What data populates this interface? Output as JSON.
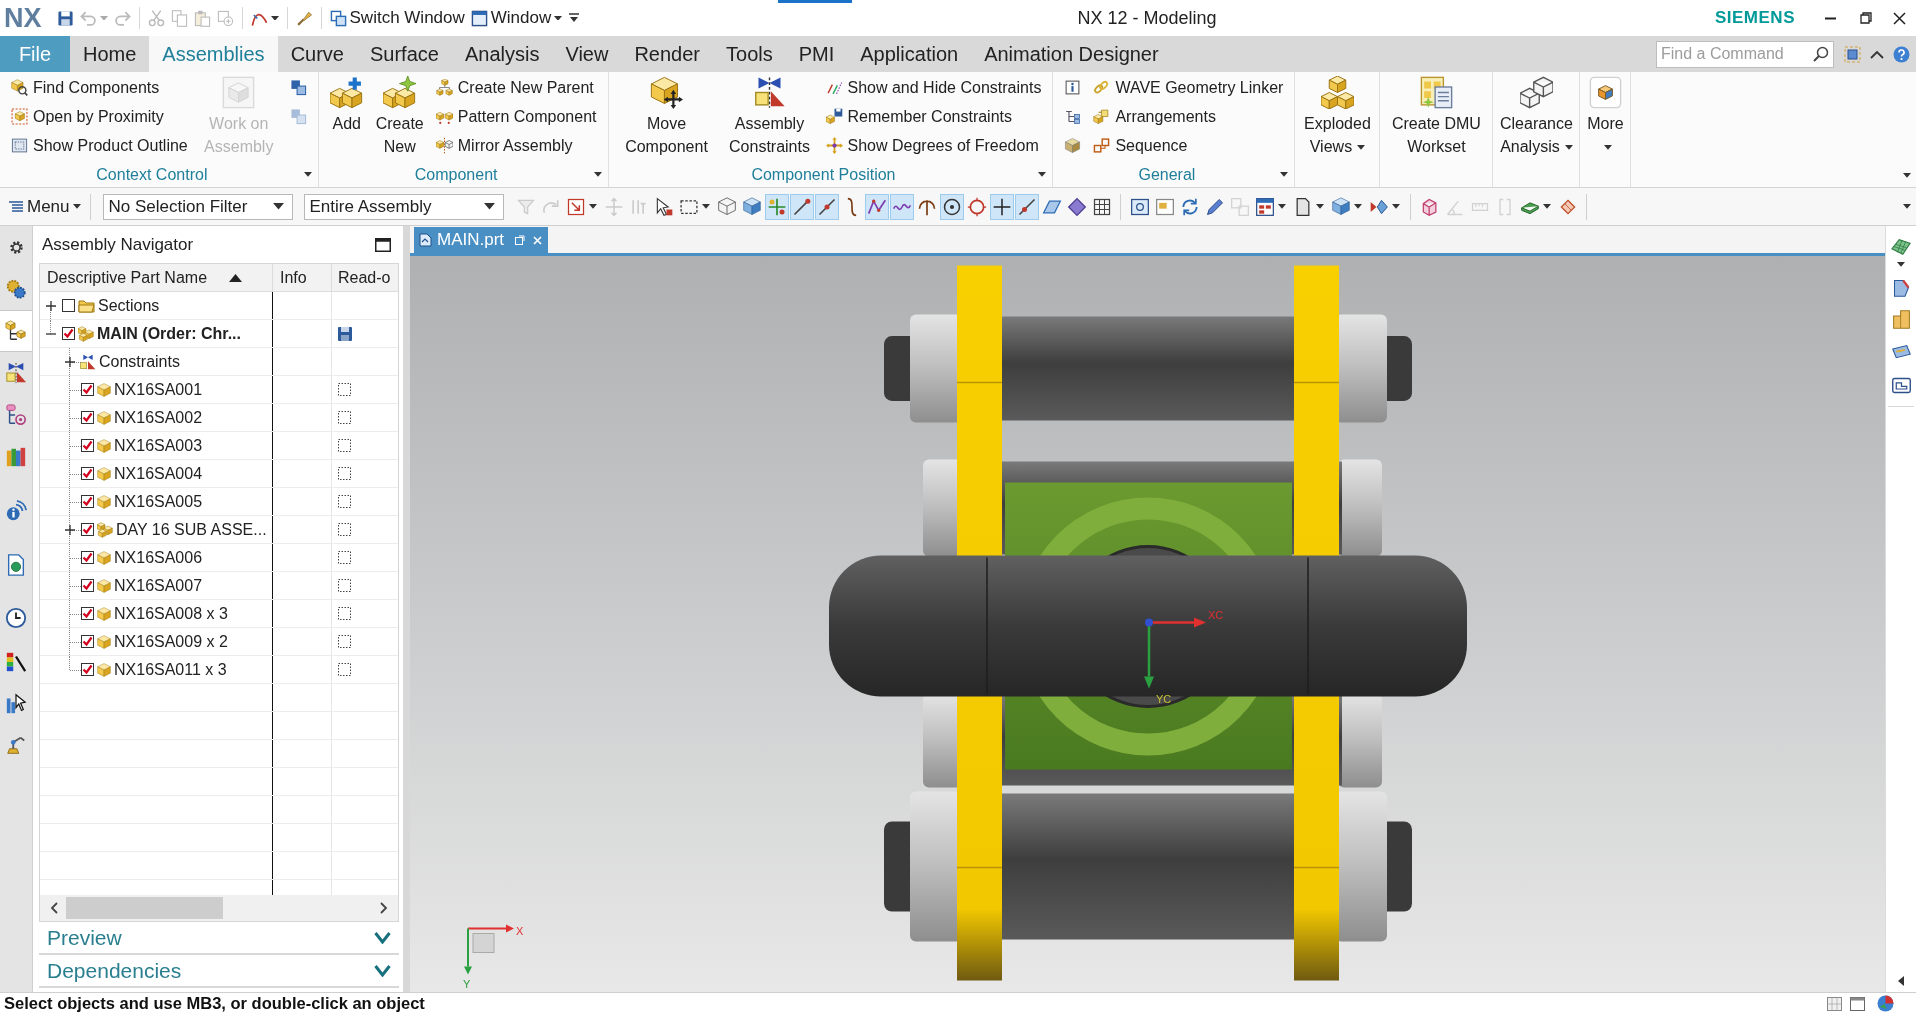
{
  "title_bar": {
    "logo": "NX",
    "title": "NX 12 - Modeling",
    "brand": "SIEMENS",
    "quick_access": [
      {
        "items": [
          {
            "disabled": false,
            "dropdown": false
          },
          {
            "disabled": true,
            "dropdown": true
          },
          {
            "disabled": true,
            "dropdown": false
          }
        ]
      },
      {
        "items": [
          {
            "disabled": true,
            "dropdown": false
          },
          {
            "disabled": true,
            "dropdown": false
          },
          {
            "disabled": true,
            "dropdown": false
          },
          {
            "disabled": true,
            "dropdown": false
          }
        ]
      },
      {
        "items": [
          {
            "disabled": false,
            "dropdown": true
          }
        ]
      },
      {
        "items": [
          {
            "disabled": false,
            "dropdown": false
          }
        ]
      },
      {
        "items": [
          {
            "label": "Switch Window",
            "disabled": false,
            "dropdown": false
          },
          {
            "label": "Window",
            "disabled": false,
            "dropdown": true
          }
        ]
      }
    ]
  },
  "ribbon_tabs": [
    {
      "label": "File",
      "kind": "file",
      "selected": false
    },
    {
      "label": "Home",
      "kind": "tab",
      "selected": false
    },
    {
      "label": "Assemblies",
      "kind": "tab",
      "selected": true
    },
    {
      "label": "Curve",
      "kind": "tab",
      "selected": false
    },
    {
      "label": "Surface",
      "kind": "tab",
      "selected": false
    },
    {
      "label": "Analysis",
      "kind": "tab",
      "selected": false
    },
    {
      "label": "View",
      "kind": "tab",
      "selected": false
    },
    {
      "label": "Render",
      "kind": "tab",
      "selected": false
    },
    {
      "label": "Tools",
      "kind": "tab",
      "selected": false
    },
    {
      "label": "PMI",
      "kind": "tab",
      "selected": false
    },
    {
      "label": "Application",
      "kind": "tab",
      "selected": false
    },
    {
      "label": "Animation Designer",
      "kind": "tab",
      "selected": false
    }
  ],
  "command_finder": {
    "placeholder": "Find a Command"
  },
  "ribbon_groups": [
    {
      "title": "Context Control",
      "blocks": [
        {
          "kind": "stack",
          "items": [
            {
              "label": "Find Components",
              "disabled": false
            },
            {
              "label": "Open by Proximity",
              "disabled": false
            },
            {
              "label": "Show Product Outline",
              "disabled": false
            }
          ]
        },
        {
          "kind": "large",
          "label": "Work on Assembly",
          "disabled": true,
          "dropdown": false
        },
        {
          "kind": "stack",
          "items": [
            {
              "disabled": false
            },
            {
              "disabled": true
            }
          ]
        }
      ]
    },
    {
      "title": "Component",
      "blocks": [
        {
          "kind": "large",
          "label": "Add",
          "disabled": false,
          "dropdown": false
        },
        {
          "kind": "large",
          "label": "Create New",
          "disabled": false,
          "dropdown": false
        },
        {
          "kind": "stack",
          "items": [
            {
              "label": "Create New Parent",
              "disabled": false
            },
            {
              "label": "Pattern Component",
              "disabled": false
            },
            {
              "label": "Mirror Assembly",
              "disabled": false
            }
          ]
        }
      ]
    },
    {
      "title": "Component Position",
      "blocks": [
        {
          "kind": "large",
          "label": "Move Component",
          "disabled": false,
          "dropdown": false
        },
        {
          "kind": "large",
          "label": "Assembly Constraints",
          "disabled": false,
          "dropdown": false
        },
        {
          "kind": "stack",
          "items": [
            {
              "label": "Show and Hide Constraints",
              "disabled": false
            },
            {
              "label": "Remember Constraints",
              "disabled": false
            },
            {
              "label": "Show Degrees of Freedom",
              "disabled": false
            }
          ]
        }
      ]
    },
    {
      "title": "General",
      "blocks": [
        {
          "kind": "stack",
          "items": [
            {
              "disabled": false
            },
            {
              "disabled": false
            },
            {
              "disabled": false
            }
          ]
        },
        {
          "kind": "stack",
          "items": [
            {
              "label": "WAVE Geometry Linker",
              "disabled": false
            },
            {
              "label": "Arrangements",
              "disabled": false
            },
            {
              "label": "Sequence",
              "disabled": false
            }
          ]
        }
      ]
    },
    {
      "blocks": [
        {
          "kind": "large",
          "label": "Exploded Views",
          "disabled": false,
          "dropdown": true
        }
      ]
    },
    {
      "blocks": [
        {
          "kind": "large",
          "label": "Create DMU Workset",
          "disabled": false,
          "dropdown": false
        }
      ]
    },
    {
      "blocks": [
        {
          "kind": "large",
          "label": "Clearance Analysis",
          "disabled": false,
          "dropdown": true
        }
      ]
    },
    {
      "blocks": [
        {
          "kind": "large",
          "label": "More",
          "disabled": false,
          "dropdown": true
        }
      ]
    }
  ],
  "selection_bar": {
    "menu": "Menu",
    "filters": [
      {
        "value": "No Selection Filter"
      },
      {
        "value": "Entire Assembly"
      }
    ],
    "tools": [
      {
        "items": [
          {
            "on": false,
            "disabled": true,
            "dropdown": false
          },
          {
            "on": false,
            "disabled": true,
            "dropdown": false
          },
          {
            "on": false,
            "disabled": false,
            "dropdown": true
          },
          {
            "on": false,
            "disabled": true,
            "dropdown": false
          },
          {
            "on": false,
            "disabled": true,
            "dropdown": false
          },
          {
            "on": false,
            "disabled": false,
            "dropdown": false
          },
          {
            "on": false,
            "disabled": false,
            "dropdown": true
          },
          {
            "on": false,
            "disabled": false,
            "dropdown": false
          },
          {
            "on": false,
            "disabled": false,
            "dropdown": false
          },
          {
            "on": true,
            "disabled": false,
            "dropdown": false
          },
          {
            "on": true,
            "disabled": false,
            "dropdown": false
          },
          {
            "on": true,
            "disabled": false,
            "dropdown": false
          },
          {
            "on": false,
            "disabled": false,
            "dropdown": false
          },
          {
            "on": true,
            "disabled": false,
            "dropdown": false
          },
          {
            "on": true,
            "disabled": false,
            "dropdown": false
          },
          {
            "on": false,
            "disabled": false,
            "dropdown": false
          },
          {
            "on": true,
            "disabled": false,
            "dropdown": false
          },
          {
            "on": false,
            "disabled": false,
            "dropdown": false
          },
          {
            "on": true,
            "disabled": false,
            "dropdown": false
          },
          {
            "on": true,
            "disabled": false,
            "dropdown": false
          },
          {
            "on": false,
            "disabled": false,
            "dropdown": false
          },
          {
            "on": false,
            "disabled": false,
            "dropdown": false
          },
          {
            "on": false,
            "disabled": false,
            "dropdown": false
          }
        ]
      },
      {
        "items": [
          {
            "on": false,
            "disabled": false,
            "dropdown": false
          },
          {
            "on": false,
            "disabled": false,
            "dropdown": false
          },
          {
            "on": false,
            "disabled": false,
            "dropdown": false
          },
          {
            "on": false,
            "disabled": false,
            "dropdown": false
          },
          {
            "on": false,
            "disabled": true,
            "dropdown": false
          },
          {
            "on": false,
            "disabled": false,
            "dropdown": true
          },
          {
            "on": false,
            "disabled": false,
            "dropdown": true
          },
          {
            "on": false,
            "disabled": false,
            "dropdown": true
          },
          {
            "on": false,
            "disabled": false,
            "dropdown": true
          }
        ]
      },
      {
        "items": [
          {
            "on": false,
            "disabled": false,
            "dropdown": false
          },
          {
            "on": false,
            "disabled": true,
            "dropdown": false
          },
          {
            "on": false,
            "disabled": true,
            "dropdown": false
          },
          {
            "on": false,
            "disabled": true,
            "dropdown": false
          },
          {
            "on": false,
            "disabled": false,
            "dropdown": true
          },
          {
            "on": false,
            "disabled": false,
            "dropdown": false
          }
        ]
      }
    ]
  },
  "resource_bar": [
    {
      "selected": false
    },
    {
      "selected": true
    },
    {
      "selected": false
    },
    {
      "selected": false
    },
    {
      "selected": false
    },
    {
      "selected": false
    },
    {
      "selected": false
    },
    {
      "selected": false
    },
    {
      "selected": false
    },
    {
      "selected": false
    },
    {
      "selected": false
    }
  ],
  "navigator": {
    "title": "Assembly Navigator",
    "columns": [
      {
        "label": "Descriptive Part Name",
        "sorted": true
      },
      {
        "label": "Info"
      },
      {
        "label": "Read-o"
      }
    ],
    "tree": [
      {
        "name": "Sections",
        "kind": "folder",
        "expanded": false,
        "checked": false,
        "work_part": false
      },
      {
        "name": "MAIN (Order: Chr...",
        "kind": "assembly",
        "expanded": true,
        "checked": true,
        "work_part": true,
        "modified": true,
        "children": [
          {
            "name": "Constraints",
            "kind": "constraints",
            "expanded": false,
            "work_part": false
          },
          {
            "name": "NX16SA001",
            "kind": "part",
            "checked": true,
            "work_part": false,
            "modified": false
          },
          {
            "name": "NX16SA002",
            "kind": "part",
            "checked": true,
            "work_part": false,
            "modified": false
          },
          {
            "name": "NX16SA003",
            "kind": "part",
            "checked": true,
            "work_part": false,
            "modified": false
          },
          {
            "name": "NX16SA004",
            "kind": "part",
            "checked": true,
            "work_part": false,
            "modified": false
          },
          {
            "name": "NX16SA005",
            "kind": "part",
            "checked": true,
            "work_part": false,
            "modified": false
          },
          {
            "name": "DAY 16 SUB ASSE...",
            "kind": "assembly",
            "expanded": false,
            "checked": true,
            "work_part": false,
            "modified": false
          },
          {
            "name": "NX16SA006",
            "kind": "part",
            "checked": true,
            "work_part": false,
            "modified": false
          },
          {
            "name": "NX16SA007",
            "kind": "part",
            "checked": true,
            "work_part": false,
            "modified": false
          },
          {
            "name": "NX16SA008 x 3",
            "kind": "part",
            "checked": true,
            "work_part": false,
            "modified": false
          },
          {
            "name": "NX16SA009 x 2",
            "kind": "part",
            "checked": true,
            "work_part": false,
            "modified": false
          },
          {
            "name": "NX16SA011 x 3",
            "kind": "part",
            "checked": true,
            "work_part": false,
            "modified": false
          }
        ]
      }
    ],
    "panels": [
      {
        "title": "Preview",
        "expanded": false
      },
      {
        "title": "Dependencies",
        "expanded": false
      }
    ]
  },
  "graphics": {
    "tabs": [
      {
        "label": "MAIN.prt",
        "selected": true
      }
    ],
    "wcs_labels": [
      "XC",
      "YC"
    ],
    "triad_labels": [
      "X",
      "Y"
    ]
  },
  "status_bar": {
    "message": "Select objects and use MB3, or double-click an object"
  }
}
